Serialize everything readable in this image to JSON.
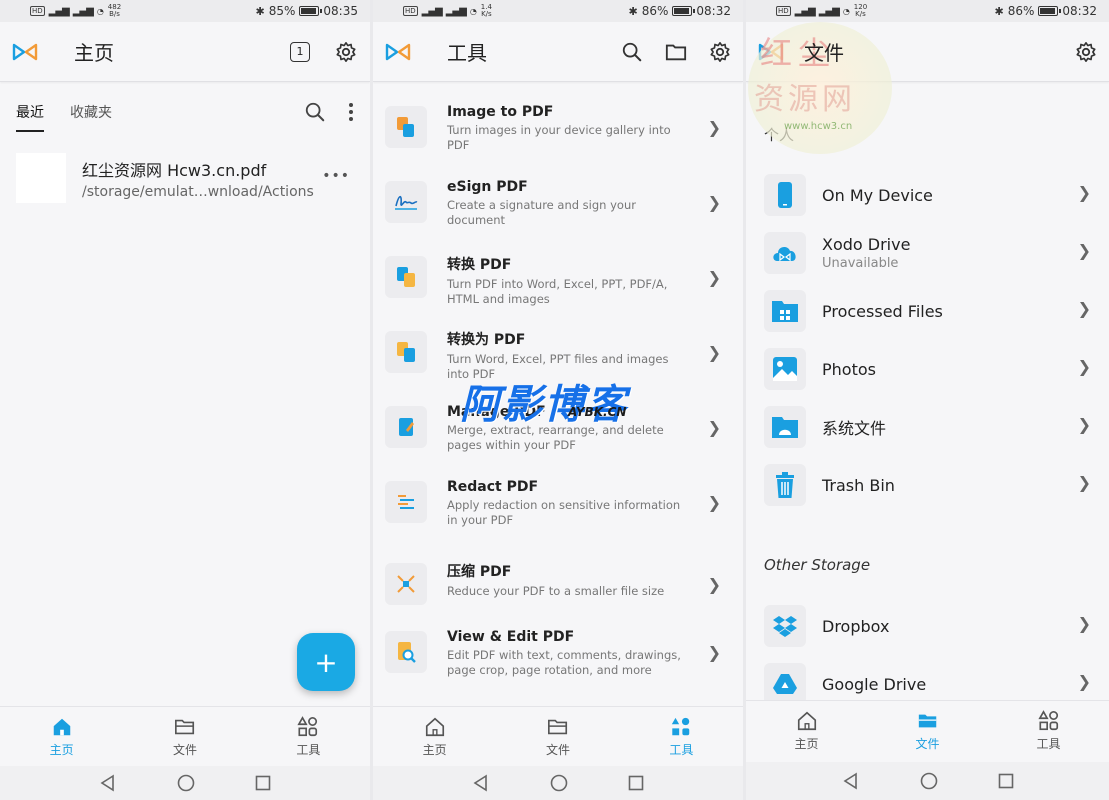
{
  "panel1": {
    "status": {
      "hd": "HD",
      "speed": "482\nB/s",
      "battery": "85%",
      "battery_level": 0.85,
      "time": "08:35"
    },
    "header": {
      "title": "主页",
      "tab_count": "1"
    },
    "subtabs": [
      "最近",
      "收藏夹"
    ],
    "recent": {
      "title": "红尘资源网 Hcw3.cn.pdf",
      "path": "/storage/emulat…wnload/Actions"
    },
    "fab": "+",
    "nav": [
      "主页",
      "文件",
      "工具"
    ]
  },
  "panel2": {
    "status": {
      "hd": "HD",
      "speed": "1.4\nK/s",
      "battery": "86%",
      "battery_level": 0.86,
      "time": "08:32"
    },
    "header": {
      "title": "工具"
    },
    "tools": [
      {
        "title": "Image to PDF",
        "desc": "Turn images in your device gallery into PDF"
      },
      {
        "title": "eSign PDF",
        "desc": "Create a signature and sign your document"
      },
      {
        "title": "转换 PDF",
        "desc": "Turn PDF into Word, Excel, PPT, PDF/A, HTML and images"
      },
      {
        "title": "转换为 PDF",
        "desc": "Turn Word, Excel, PPT files and images into PDF"
      },
      {
        "title": "Manage PDF",
        "desc": "Merge, extract, rearrange, and delete pages within your PDF"
      },
      {
        "title": "Redact PDF",
        "desc": "Apply redaction on sensitive information in your PDF"
      },
      {
        "title": "压缩 PDF",
        "desc": "Reduce your PDF to a smaller file size"
      },
      {
        "title": "View & Edit PDF",
        "desc": "Edit PDF with text, comments, drawings, page crop, page rotation, and more"
      }
    ],
    "nav": [
      "主页",
      "文件",
      "工具"
    ]
  },
  "panel3": {
    "status": {
      "hd": "HD",
      "speed": "120\nK/s",
      "battery": "86%",
      "battery_level": 0.86,
      "time": "08:32"
    },
    "header": {
      "title": "文件"
    },
    "section_personal": "个人",
    "personal": [
      {
        "label": "On My Device",
        "sub": ""
      },
      {
        "label": "Xodo Drive",
        "sub": "Unavailable"
      },
      {
        "label": "Processed Files",
        "sub": ""
      },
      {
        "label": "Photos",
        "sub": ""
      },
      {
        "label": "系统文件",
        "sub": ""
      },
      {
        "label": "Trash Bin",
        "sub": ""
      }
    ],
    "section_other": "Other Storage",
    "other": [
      {
        "label": "Dropbox"
      },
      {
        "label": "Google Drive"
      }
    ],
    "nav": [
      "主页",
      "文件",
      "工具"
    ]
  },
  "watermarks": {
    "w1_line1": "红尘",
    "w1_line2": "资源网",
    "w1_url": "www.hcw3.cn",
    "w2_main": "阿影博客",
    "w2_sub": "AYBK.CN"
  },
  "colors": {
    "accent": "#1aa9e4",
    "active_nav": "#1a9fe0"
  }
}
